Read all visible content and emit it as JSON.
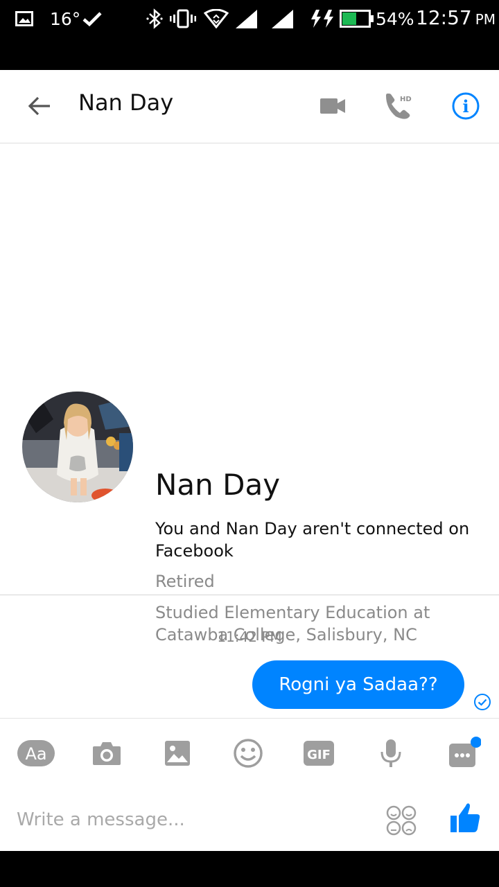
{
  "status_bar": {
    "temperature": "16°",
    "battery_percent": "54%",
    "battery_level": 0.54,
    "time": "12:57",
    "ampm": "PM",
    "icons": [
      "gallery-icon",
      "check-icon",
      "bluetooth-icon",
      "vibrate-icon",
      "wifi-icon",
      "signal-icon",
      "signal-icon",
      "charging-icon",
      "battery-icon"
    ]
  },
  "header": {
    "title": "Nan Day",
    "icons": [
      "back-arrow-icon",
      "video-camera-icon",
      "hd-phone-icon",
      "info-icon"
    ],
    "hd_label": "HD",
    "info_glyph": "i"
  },
  "profile": {
    "name": "Nan Day",
    "connection_text": "You and Nan Day aren't connected on Facebook",
    "job": "Retired",
    "education": "Studied Elementary Education at Catawba College, Salisbury, NC"
  },
  "conversation": {
    "timestamp": "11:42 PM",
    "messages": [
      {
        "text": "Rogni ya Sadaa??",
        "outgoing": true,
        "status": "sent"
      }
    ]
  },
  "composer": {
    "placeholder": "Write a message...",
    "aa_label": "Aa",
    "gif_label": "GIF",
    "tools": [
      "text-size-icon",
      "camera-icon",
      "image-icon",
      "emoji-icon",
      "gif-icon",
      "microphone-icon",
      "more-icon",
      "stickers-icon",
      "thumbs-up-icon"
    ]
  },
  "colors": {
    "accent": "#0084ff",
    "icon_gray": "#9e9e9e",
    "status_green": "#1db954",
    "notification_dot": "#0084ff"
  }
}
